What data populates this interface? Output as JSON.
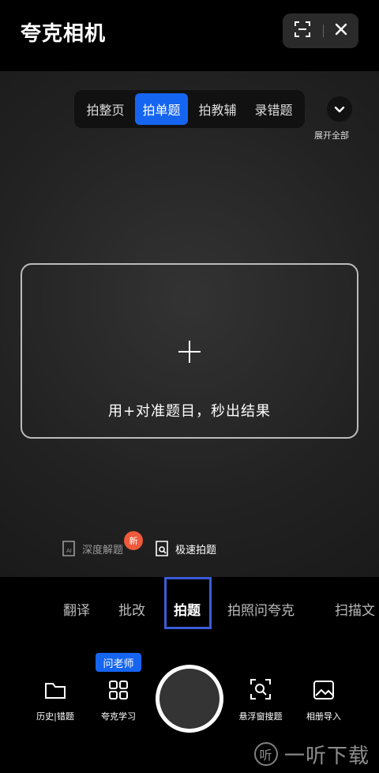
{
  "header": {
    "title": "夸克相机",
    "scan_icon": "scan-frame-icon",
    "close_icon": "close-icon"
  },
  "mode_tabs": [
    {
      "label": "拍整页",
      "active": false
    },
    {
      "label": "拍单题",
      "active": true
    },
    {
      "label": "拍教辅",
      "active": false
    },
    {
      "label": "录错题",
      "active": false
    }
  ],
  "expand": {
    "label": "展开全部",
    "icon": "chevron-down-icon"
  },
  "frame": {
    "hint": "用+对准题目，秒出结果"
  },
  "options": {
    "deep": {
      "label": "深度解题",
      "badge": "新",
      "icon": "ai-doc-icon"
    },
    "fast": {
      "label": "极速拍题",
      "icon": "doc-search-icon"
    }
  },
  "function_tabs": [
    {
      "label": "翻译",
      "active": false
    },
    {
      "label": "批改",
      "active": false
    },
    {
      "label": "拍题",
      "active": true
    },
    {
      "label": "拍照问夸克",
      "active": false
    },
    {
      "label": "扫描文",
      "active": false
    }
  ],
  "tools": {
    "history": {
      "label": "历史|错题",
      "icon": "folder-icon"
    },
    "study": {
      "label": "夸克学习",
      "badge": "问老师",
      "icon": "grid-icon"
    },
    "float": {
      "label": "悬浮窗搜题",
      "icon": "scan-search-icon"
    },
    "album": {
      "label": "相册导入",
      "icon": "image-icon"
    }
  },
  "watermark": {
    "text": "一听下载",
    "icon_glyph": "听"
  },
  "colors": {
    "accent": "#1565f1",
    "badge": "#f05a3c",
    "focus": "#3b5bd8"
  }
}
